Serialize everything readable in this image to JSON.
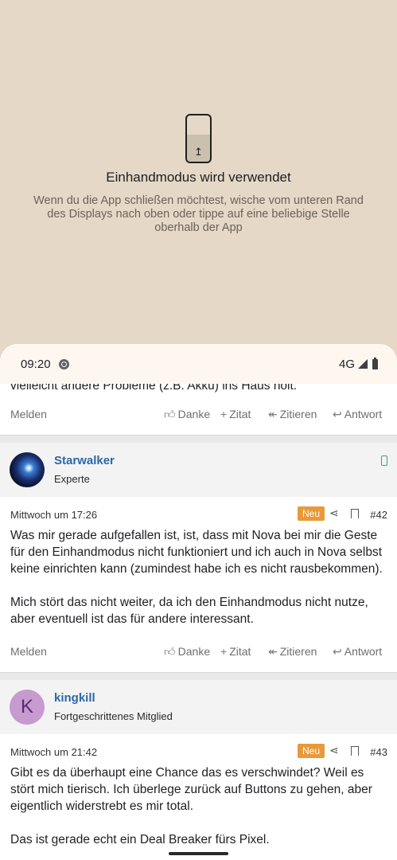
{
  "one_handed": {
    "title": "Einhandmodus wird verwendet",
    "description": "Wenn du die App schließen möchtest, wische vom unteren Rand des Displays nach oben oder tippe auf eine beliebige Stelle oberhalb der App"
  },
  "statusbar": {
    "time": "09:20",
    "network": "4G"
  },
  "cut_text": "vielleicht andere Probleme (z.B. Akku) ins Haus holt.",
  "actions": {
    "melden": "Melden",
    "danke": "Danke",
    "zitat": "Zitat",
    "zitieren": "Zitieren",
    "antwort": "Antwort"
  },
  "posts": [
    {
      "author": "Starwalker",
      "role": "Experte",
      "date": "Mittwoch um 17:26",
      "badge": "Neu",
      "number": "#42",
      "paragraphs": [
        "Was mir gerade aufgefallen ist, ist, dass mit Nova bei mir die Geste für den Einhandmodus nicht funktioniert und ich auch in Nova selbst keine einrichten kann (zumindest habe ich es nicht rausbekommen).",
        "Mich stört das nicht weiter, da ich den Einhandmodus nicht nutze, aber eventuell ist das für andere interessant."
      ]
    },
    {
      "author": "kingkill",
      "avatar_letter": "K",
      "role": "Fortgeschrittenes Mitglied",
      "date": "Mittwoch um 21:42",
      "badge": "Neu",
      "number": "#43",
      "paragraphs": [
        "Gibt es da überhaupt eine Chance das es verschwindet? Weil es stört mich tierisch. Ich überlege zurück auf Buttons zu gehen, aber eigentlich widerstrebt es mir total.",
        "Das ist gerade echt ein Deal Breaker fürs Pixel."
      ]
    }
  ]
}
